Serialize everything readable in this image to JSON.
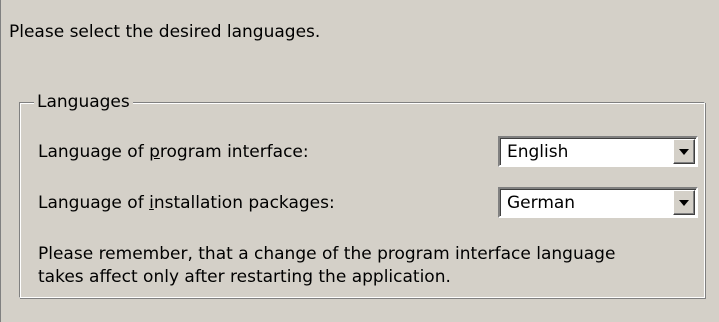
{
  "instruction": "Please select the desired languages.",
  "languages_group": {
    "title": "Languages",
    "program_interface": {
      "label_pre": "Language of ",
      "label_underlined": "p",
      "label_post": "rogram interface:",
      "selected": "English"
    },
    "installation_packages": {
      "label_pre": "Language of ",
      "label_underlined": "i",
      "label_post": "nstallation packages:",
      "selected": "German"
    },
    "note_line1": "Please remember, that a change of the program interface language",
    "note_line2": "takes affect only after restarting the application."
  },
  "icons": {
    "dropdown": "chevron-down-icon"
  }
}
